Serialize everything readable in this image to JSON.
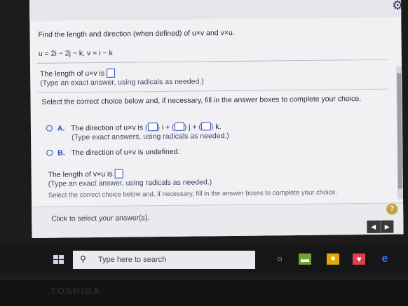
{
  "problem": {
    "title": "Find the length and direction (when defined) of u×v and v×u.",
    "vectors": "u = 2i − 2j − k,   v = i − k"
  },
  "part1": {
    "prompt": "The length of u×v is",
    "hint": "(Type an exact answer, using radicals as needed.)",
    "value": ""
  },
  "choice_prompt": "Select the correct choice below and, if necessary, fill in the answer boxes to complete your choice.",
  "options": [
    {
      "letter": "A.",
      "text": "The direction of u×v is",
      "i": "i +",
      "j": "j +",
      "k": "k.",
      "hint": "(Type exact answers, using radicals as needed.)"
    },
    {
      "letter": "B.",
      "text": "The direction of u×v is undefined."
    }
  ],
  "part2": {
    "prompt": "The length of v×u is",
    "hint": "(Type an exact answer, using radicals as needed.)",
    "value": ""
  },
  "choice_prompt_2": "Select the correct choice below and, if necessary, fill in the answer boxes to complete your choice.",
  "footer": {
    "instruction": "Click to select your answer(s).",
    "help": "?",
    "prev": "◀",
    "next": "▶"
  },
  "taskbar": {
    "search_placeholder": "Type here to search"
  },
  "bezel": {
    "brand": "TOSHIBA"
  },
  "colors": {
    "accent": "#2a4bb5",
    "page": "#f1f1f4",
    "taskbar": "#161618"
  },
  "icons": [
    "gear-icon",
    "help-icon",
    "search-icon",
    "windows-icon",
    "cortana-icon",
    "task-view-icon",
    "store-icon",
    "heart-app-icon",
    "edge-icon"
  ]
}
